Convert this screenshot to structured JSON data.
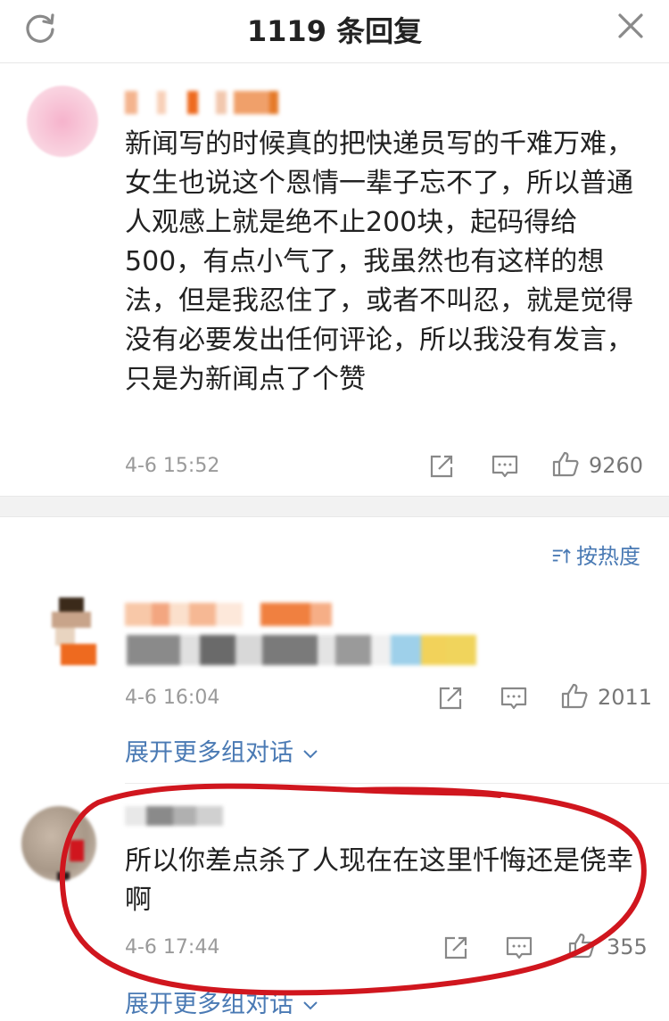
{
  "header": {
    "title": "1119 条回复",
    "refresh_icon": "refresh-icon",
    "close_icon": "close-icon"
  },
  "top_comment": {
    "text": "新闻写的时候真的把快递员写的千难万难，女生也说这个恩情一辈子忘不了，所以普通人观感上就是绝不止200块，起码得给500，有点小气了，我虽然也有这样的想法，但是我忍住了，或者不叫忍，就是觉得没有必要发出任何评论，所以我没有发言，只是为新闻点了个赞",
    "time": "4-6 15:52",
    "likes": "9260"
  },
  "sort_label": "按热度",
  "replies": [
    {
      "time": "4-6 16:04",
      "likes": "2011",
      "expand": "展开更多组对话"
    },
    {
      "text": "所以你差点杀了人现在在这里忏悔还是侥幸啊",
      "time": "4-6 17:44",
      "likes": "355",
      "expand": "展开更多组对话"
    }
  ],
  "colors": {
    "link": "#4a7ab4",
    "meta": "#9a9a9a",
    "annotation": "#d0161e"
  }
}
